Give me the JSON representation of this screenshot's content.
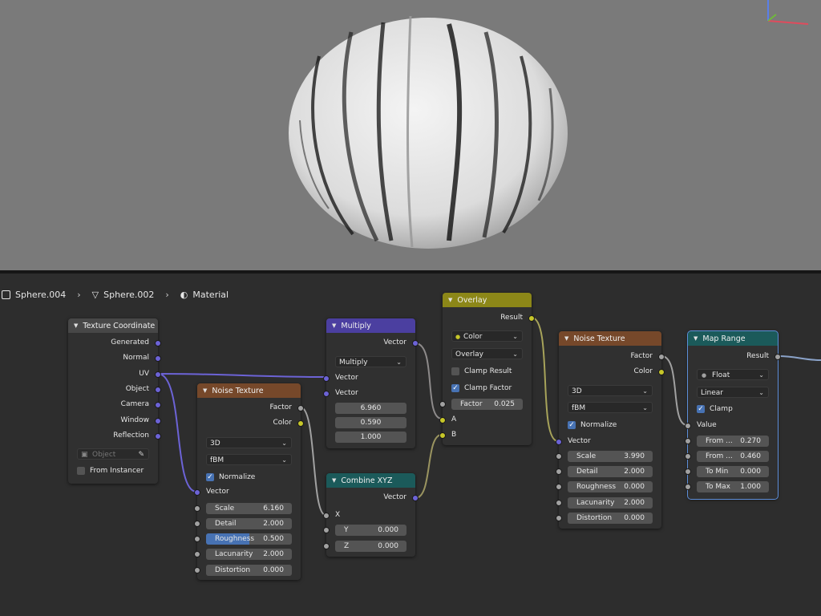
{
  "breadcrumb": {
    "object": "Sphere.004",
    "mesh": "Sphere.002",
    "material": "Material"
  },
  "nodes": {
    "texcoord": {
      "title": "Texture Coordinate",
      "outputs": [
        "Generated",
        "Normal",
        "UV",
        "Object",
        "Camera",
        "Window",
        "Reflection"
      ],
      "object_placeholder": "Object",
      "from_instancer": "From Instancer"
    },
    "noise1": {
      "title": "Noise Texture",
      "outputs": [
        "Factor",
        "Color"
      ],
      "dimension": "3D",
      "type": "fBM",
      "normalize": "Normalize",
      "vector": "Vector",
      "fields": [
        {
          "label": "Scale",
          "value": "6.160"
        },
        {
          "label": "Detail",
          "value": "2.000"
        },
        {
          "label": "Roughness",
          "value": "0.500",
          "fill": 0.5
        },
        {
          "label": "Lacunarity",
          "value": "2.000"
        },
        {
          "label": "Distortion",
          "value": "0.000"
        }
      ]
    },
    "multiply": {
      "title": "Multiply",
      "output": "Vector",
      "operation": "Multiply",
      "inputs": [
        "Vector",
        "Vector"
      ],
      "values": [
        "6.960",
        "0.590",
        "1.000"
      ]
    },
    "combine": {
      "title": "Combine XYZ",
      "output": "Vector",
      "x": "X",
      "y_label": "Y",
      "y_value": "0.000",
      "z_label": "Z",
      "z_value": "0.000"
    },
    "overlay": {
      "title": "Overlay",
      "output": "Result",
      "data_type": "Color",
      "blend": "Overlay",
      "clamp_result": "Clamp Result",
      "clamp_factor": "Clamp Factor",
      "factor_label": "Factor",
      "factor_value": "0.025",
      "a": "A",
      "b": "B"
    },
    "noise2": {
      "title": "Noise Texture",
      "outputs": [
        "Factor",
        "Color"
      ],
      "dimension": "3D",
      "type": "fBM",
      "normalize": "Normalize",
      "vector": "Vector",
      "fields": [
        {
          "label": "Scale",
          "value": "3.990"
        },
        {
          "label": "Detail",
          "value": "2.000"
        },
        {
          "label": "Roughness",
          "value": "0.000"
        },
        {
          "label": "Lacunarity",
          "value": "2.000"
        },
        {
          "label": "Distortion",
          "value": "0.000"
        }
      ]
    },
    "maprange": {
      "title": "Map Range",
      "output": "Result",
      "data_type": "Float",
      "interpolation": "Linear",
      "clamp": "Clamp",
      "value": "Value",
      "fields": [
        {
          "label": "From ...",
          "value": "0.270"
        },
        {
          "label": "From ...",
          "value": "0.460"
        },
        {
          "label": "To Min",
          "value": "0.000"
        },
        {
          "label": "To Max",
          "value": "1.000"
        }
      ]
    }
  },
  "colors": {
    "vector_socket": "#6c63d6",
    "color_socket": "#c7c729",
    "float_socket": "#a1a1a1",
    "texture_header": "#76482a",
    "vector_header": "#4b3fa0",
    "color_header": "#8c8718",
    "converter_header": "#1b5a5a",
    "selection": "#5d8ed8"
  }
}
